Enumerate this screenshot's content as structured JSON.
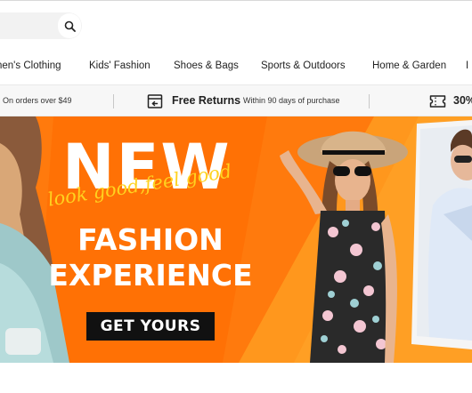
{
  "search": {
    "placeholder": "",
    "icon": "search-icon"
  },
  "nav": {
    "items": [
      {
        "label": "nen's Clothing"
      },
      {
        "label": "Kids' Fashion"
      },
      {
        "label": "Shoes & Bags"
      },
      {
        "label": "Sports & Outdoors"
      },
      {
        "label": "Home & Garden"
      },
      {
        "label": "I"
      }
    ]
  },
  "benefits": {
    "shipping_sub": "On orders over $49",
    "returns_title": "Free Returns",
    "returns_sub": "Within 90 days of purchase",
    "returns_icon": "return-box-icon",
    "coupon_title": "30%",
    "coupon_icon": "coupon-icon"
  },
  "banner": {
    "headline": "NEW",
    "script": "look good,feel good",
    "line1": "FASHION",
    "line2": "EXPERIENCE",
    "cta": "GET YOURS",
    "colors": {
      "background": "#ff7a0d",
      "script": "#ffd21f",
      "cta_bg": "#111111",
      "text": "#ffffff"
    }
  }
}
